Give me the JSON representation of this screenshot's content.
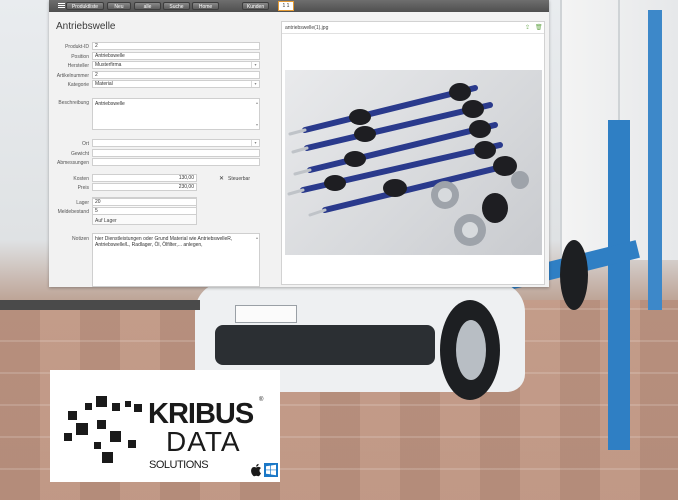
{
  "toolbar": {
    "buttons": [
      "Produktliste",
      "Neu",
      "alle",
      "Suche",
      "Home",
      "Kunden"
    ],
    "counter": "1 1"
  },
  "title": "Antriebswelle",
  "form": {
    "produkt_id": {
      "label": "Produkt-ID",
      "value": "2"
    },
    "position": {
      "label": "Position",
      "value": "Antriebswelle"
    },
    "hersteller": {
      "label": "Hersteller",
      "value": "Musterfirma"
    },
    "artikelnummer": {
      "label": "Artikelnummer",
      "value": "2"
    },
    "kategorie": {
      "label": "Kategorie",
      "value": "Material"
    },
    "beschreibung": {
      "label": "Beschreibung",
      "value": "Antriebswelle"
    },
    "ort": {
      "label": "Ort",
      "value": ""
    },
    "gewicht": {
      "label": "Gewicht",
      "value": ""
    },
    "abmessungen": {
      "label": "Abmessungen",
      "value": ""
    },
    "kosten": {
      "label": "Kosten",
      "value": "130,00"
    },
    "preis": {
      "label": "Preis",
      "value": "230,00"
    },
    "steuerbar": {
      "label": "Steuerbar",
      "checked": true,
      "mark": "✕"
    },
    "lager": {
      "label": "Lager",
      "value": "20"
    },
    "meldebestand": {
      "label": "Meldebestand",
      "value": "5"
    },
    "lager_status": "Auf Lager",
    "notizen": {
      "label": "Notizen",
      "value": "hier Dienstleistungen oder Grund Material wie AntriebswelleR, Antriebswelle/L, Radlager, Öl, Ölfilter,... anlegen,"
    }
  },
  "image": {
    "filename": "antriebswelle(1).jpg",
    "upload_icon": "upload-icon",
    "delete_icon": "trash-icon"
  },
  "logo": {
    "kribus": "KRIBUS",
    "registered": "®",
    "data": "DATA",
    "solutions": "SOLUTIONS"
  },
  "colors": {
    "toolbar": "#5a5a5a",
    "accent": "#e49b35",
    "lift_blue": "#2f7fc4",
    "windows_blue": "#1b78c7"
  }
}
